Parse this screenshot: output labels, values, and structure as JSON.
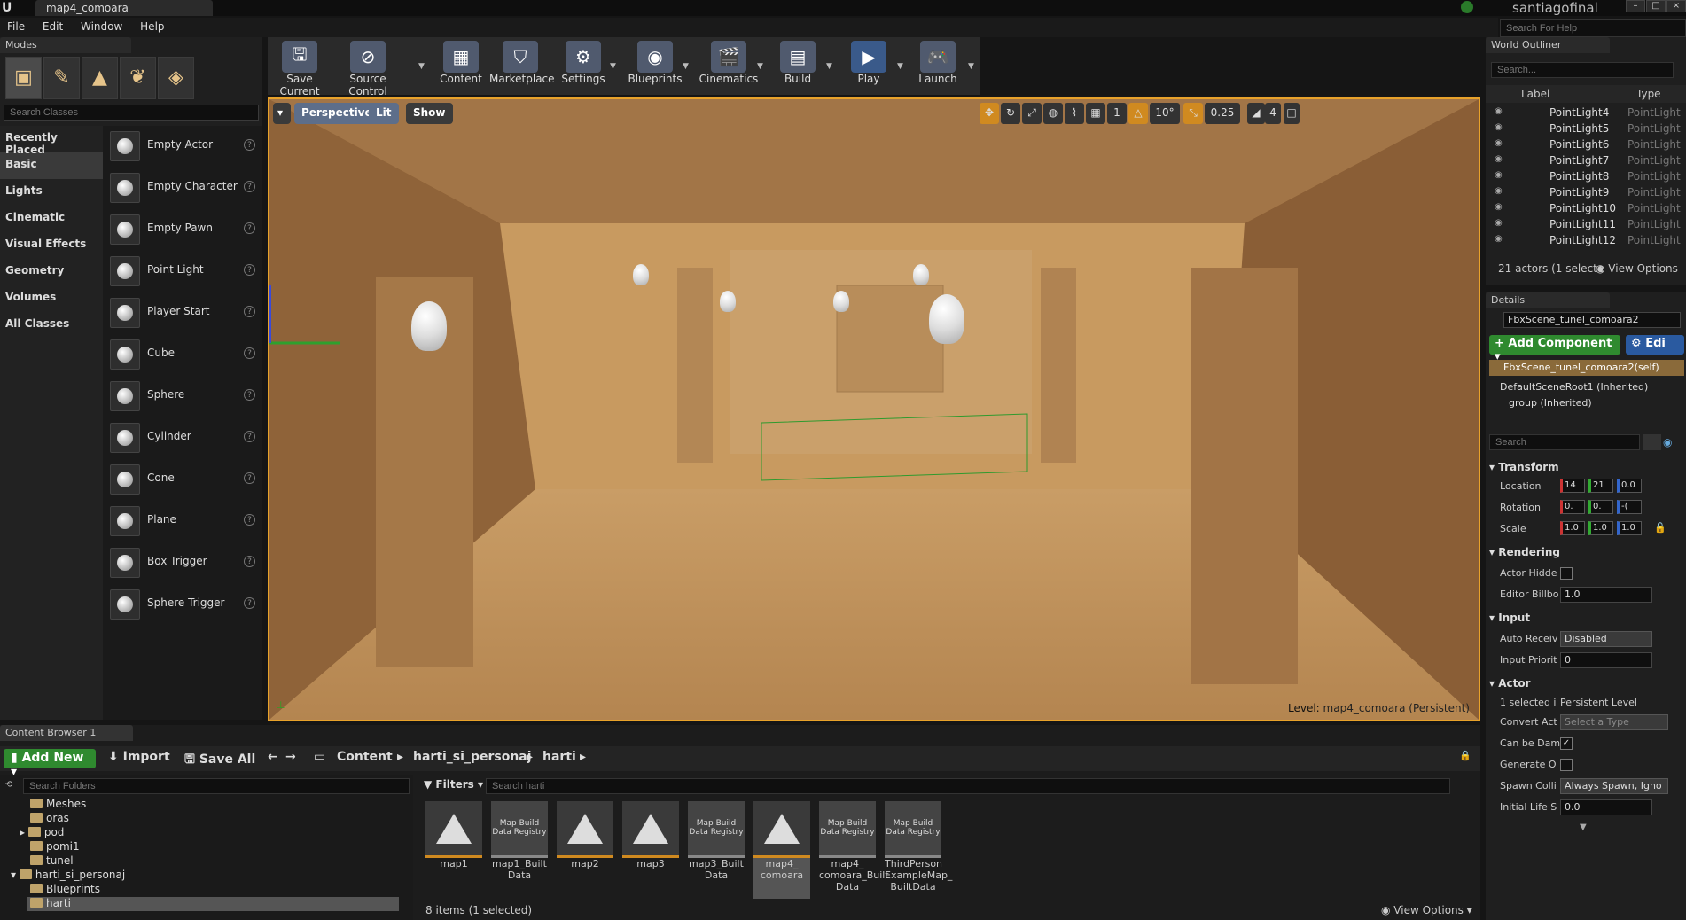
{
  "titlebar": {
    "tab_title": "map4_comoara",
    "user": "santiagofinal",
    "help_placeholder": "Search For Help"
  },
  "menu": [
    "File",
    "Edit",
    "Window",
    "Help"
  ],
  "modes": {
    "tab": "Modes",
    "search_placeholder": "Search Classes",
    "categories": [
      "Recently Placed",
      "Basic",
      "Lights",
      "Cinematic",
      "Visual Effects",
      "Geometry",
      "Volumes",
      "All Classes"
    ],
    "selected_category": "Basic",
    "actors": [
      "Empty Actor",
      "Empty Character",
      "Empty Pawn",
      "Point Light",
      "Player Start",
      "Cube",
      "Sphere",
      "Cylinder",
      "Cone",
      "Plane",
      "Box Trigger",
      "Sphere Trigger"
    ]
  },
  "toolbar": [
    "Save Current",
    "Source Control",
    "Content",
    "Marketplace",
    "Settings",
    "Blueprints",
    "Cinematics",
    "Build",
    "Play",
    "Launch"
  ],
  "viewport": {
    "perspective": "Perspective",
    "lit": "Lit",
    "show": "Show",
    "angle": "10°",
    "scale": "0.25",
    "cam_speed": "4",
    "level_label": "Level:",
    "level_name": "map4_comoara (Persistent)"
  },
  "outliner": {
    "tab": "World Outliner",
    "search_placeholder": "Search...",
    "col_label": "Label",
    "col_type": "Type",
    "rows": [
      {
        "name": "PointLight4",
        "type": "PointLight"
      },
      {
        "name": "PointLight5",
        "type": "PointLight"
      },
      {
        "name": "PointLight6",
        "type": "PointLight"
      },
      {
        "name": "PointLight7",
        "type": "PointLight"
      },
      {
        "name": "PointLight8",
        "type": "PointLight"
      },
      {
        "name": "PointLight9",
        "type": "PointLight"
      },
      {
        "name": "PointLight10",
        "type": "PointLight"
      },
      {
        "name": "PointLight11",
        "type": "PointLight"
      },
      {
        "name": "PointLight12",
        "type": "PointLight"
      }
    ],
    "footer": "21 actors (1 selecte",
    "view_options": "View Options"
  },
  "details": {
    "tab": "Details",
    "actor_name": "FbxScene_tunel_comoara2",
    "add_component": "Add Component",
    "edit": "Edi",
    "self_component": "FbxScene_tunel_comoara2(self)",
    "tree": [
      "DefaultSceneRoot1 (Inherited)",
      "group (Inherited)"
    ],
    "search_placeholder": "Search",
    "transform": {
      "title": "Transform",
      "location_label": "Location",
      "rotation_label": "Rotation",
      "scale_label": "Scale",
      "location": [
        "14",
        "21",
        "0.0"
      ],
      "rotation": [
        "0.",
        "0.",
        "-("
      ],
      "scale": [
        "1.0",
        "1.0",
        "1.0"
      ]
    },
    "rendering": {
      "title": "Rendering",
      "actor_hidden": "Actor Hidde",
      "editor_billboard": "Editor Billbo",
      "billboard_value": "1.0"
    },
    "input": {
      "title": "Input",
      "auto_receive": "Auto Receiv",
      "auto_receive_value": "Disabled",
      "input_priority": "Input Priorit",
      "priority_value": "0"
    },
    "actor": {
      "title": "Actor",
      "selected_in": "1 selected i",
      "level": "Persistent Level",
      "convert": "Convert Act",
      "convert_value": "Select a Type",
      "can_be_damaged": "Can be Dam",
      "generate": "Generate O",
      "spawn": "Spawn Colli",
      "spawn_value": "Always Spawn, Igno",
      "life": "Initial Life S",
      "life_value": "0.0"
    }
  },
  "content_browser": {
    "tab": "Content Browser 1",
    "add_new": "Add New",
    "import": "Import",
    "save_all": "Save All",
    "path": [
      "Content",
      "harti_si_personaj",
      "harti"
    ],
    "folder_search": "Search Folders",
    "folders": [
      "Meshes",
      "oras",
      "pod",
      "pomi1",
      "tunel",
      "harti_si_personaj",
      "Blueprints",
      "harti"
    ],
    "filters": "Filters",
    "asset_search": "Search harti",
    "assets": [
      {
        "name": "map1",
        "kind": "map"
      },
      {
        "name": "map1_Built Data",
        "kind": "reg"
      },
      {
        "name": "map2",
        "kind": "map"
      },
      {
        "name": "map3",
        "kind": "map"
      },
      {
        "name": "map3_Built Data",
        "kind": "reg"
      },
      {
        "name": "map4_ comoara",
        "kind": "map"
      },
      {
        "name": "map4_ comoara_Built Data",
        "kind": "reg"
      },
      {
        "name": "ThirdPerson ExampleMap_ BuiltData",
        "kind": "reg"
      }
    ],
    "registry_label": "Map Build Data Registry",
    "status": "8 items (1 selected)",
    "view_options": "View Options"
  },
  "colors": {
    "accent": "#e8a22a",
    "add_green": "#2f8a2f",
    "scene": "#c89a60"
  }
}
